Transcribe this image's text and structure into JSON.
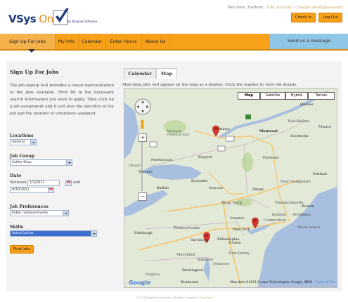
{
  "header": {
    "logo_vsys": "VSys",
    "logo_one": "One",
    "logo_by": "By Bespoke Software",
    "welcome_prefix": "Welcome, Herbert · ",
    "edit_account": "Edit account",
    "sep": " · ",
    "change_email": "Change email/password",
    "checkin_label": "Check In",
    "logout_label": "Log Out"
  },
  "nav": {
    "items": [
      "Sign Up For Jobs",
      "My Info",
      "Calendar",
      "Enter Hours",
      "About Us"
    ],
    "message_label": "Send us a message"
  },
  "left": {
    "title": "Sign Up For Jobs",
    "description": "The job signup tool provides a visual representation of the jobs available. First fill in the necessary search information you wish to apply. Then click on a job assignment and it will give the specifics of the job and the number of volunteers assigned.",
    "locations_label": "Locations",
    "locations_value": "General",
    "job_group_label": "Job Group",
    "job_group_value": "Coffee Shop",
    "date_label": "Date",
    "between_label": "Between",
    "date_from": "1/1/2011",
    "and_label": "and",
    "date_to": "9/30/2011",
    "job_pref_label": "Job Preferences",
    "job_pref_value": "Public relations/media",
    "skills_label": "Skills",
    "skills_value": "Sales/Cashier",
    "find_jobs_label": "Find Jobs"
  },
  "tabs": [
    "Calendar",
    "Map"
  ],
  "map": {
    "caption": "Matching jobs will appear on the map as a marker. Click the marker to view job details.",
    "types": [
      "Map",
      "Satellite",
      "Hybrid",
      "Terrain"
    ],
    "google": "Google",
    "attribution": "Map data ©2011 Europa Technologies, Google, INEGI - ",
    "terms": "Terms of Use",
    "labels": {
      "ottawa": "Ottawa",
      "montreal": "Montreal",
      "quebec": "Québec",
      "toronto": "Toronto",
      "new_york": "New York",
      "boston": "Boston",
      "philadelphia": "Philadelphia",
      "pittsburgh": "Pittsburgh",
      "washington": "Washington",
      "vermont": "Vermont",
      "maine": "Maine",
      "new_hampshire": "New Hampshire",
      "massachusetts": "Massachusetts",
      "connecticut": "Connecticut",
      "pennsylvania": "Pennsylvania",
      "maryland": "Maryland",
      "new_jersey": "New Jersey",
      "delaware": "Delaware",
      "virginia": "Virginia",
      "richmond": "Richmond",
      "ontario": "Ontario",
      "buffalo": "Buffalo",
      "rochester": "Rochester",
      "albany": "Albany",
      "portland": "Portland",
      "trois_rivieres": "Trois-Rivières",
      "sherbrooke": "Sherbrooke",
      "algonquin": "Algonquin Provincial Park",
      "peterborough": "Peterborough",
      "kingston": "Kingston",
      "syracuse": "Syracuse",
      "scranton": "Scranton",
      "baltimore": "Baltimore",
      "providence": "Providence",
      "hartford": "Hartford",
      "rhode_island": "Rhode Island",
      "harrisburg": "Harrisburg",
      "trenton": "Trenton"
    }
  },
  "footer": {
    "copyright": "©2011 Bespoke Software. All rights reserved. ",
    "link": "Close site"
  },
  "colors": {
    "nav_orange": "#f7a11a",
    "message_blue": "#8fc6e6",
    "marker_red": "#d8342a"
  }
}
